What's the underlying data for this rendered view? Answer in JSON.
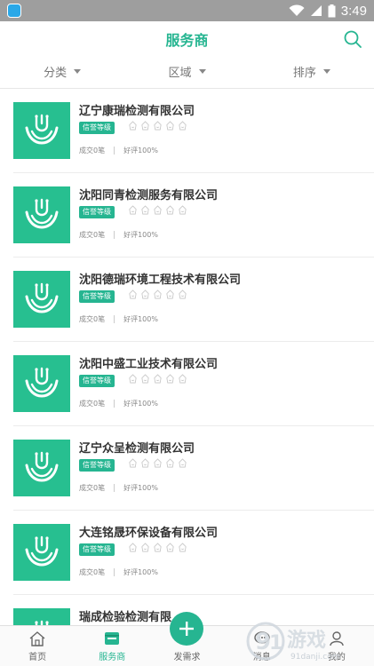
{
  "status_bar": {
    "time": "3:49"
  },
  "header": {
    "title": "服务商"
  },
  "filters": [
    {
      "label": "分类"
    },
    {
      "label": "区域"
    },
    {
      "label": "排序"
    }
  ],
  "providers": [
    {
      "name": "辽宁康瑞检测有限公司",
      "badge": "信誉等级",
      "deals": "成交0笔",
      "rating": "好评100%"
    },
    {
      "name": "沈阳同青检测服务有限公司",
      "badge": "信誉等级",
      "deals": "成交0笔",
      "rating": "好评100%"
    },
    {
      "name": "沈阳德瑞环境工程技术有限公司",
      "badge": "信誉等级",
      "deals": "成交0笔",
      "rating": "好评100%"
    },
    {
      "name": "沈阳中盛工业技术有限公司",
      "badge": "信誉等级",
      "deals": "成交0笔",
      "rating": "好评100%"
    },
    {
      "name": "辽宁众呈检测有限公司",
      "badge": "信誉等级",
      "deals": "成交0笔",
      "rating": "好评100%"
    },
    {
      "name": "大连铭晟环保设备有限公司",
      "badge": "信誉等级",
      "deals": "成交0笔",
      "rating": "好评100%"
    },
    {
      "name": "瑞成检验检测有限",
      "badge": "",
      "deals": "",
      "rating": ""
    }
  ],
  "bottom_nav": [
    {
      "label": "首页",
      "icon": "home-icon"
    },
    {
      "label": "服务商",
      "icon": "store-icon"
    },
    {
      "label": "发需求",
      "icon": "plus-icon"
    },
    {
      "label": "消息",
      "icon": "chat-icon"
    },
    {
      "label": "我的",
      "icon": "user-icon"
    }
  ],
  "watermark": {
    "text": "游戏",
    "domain": "91danji.com"
  },
  "colors": {
    "accent": "#26b591",
    "logo_bg": "#27bf90",
    "status_bar": "#9e9e9e"
  }
}
